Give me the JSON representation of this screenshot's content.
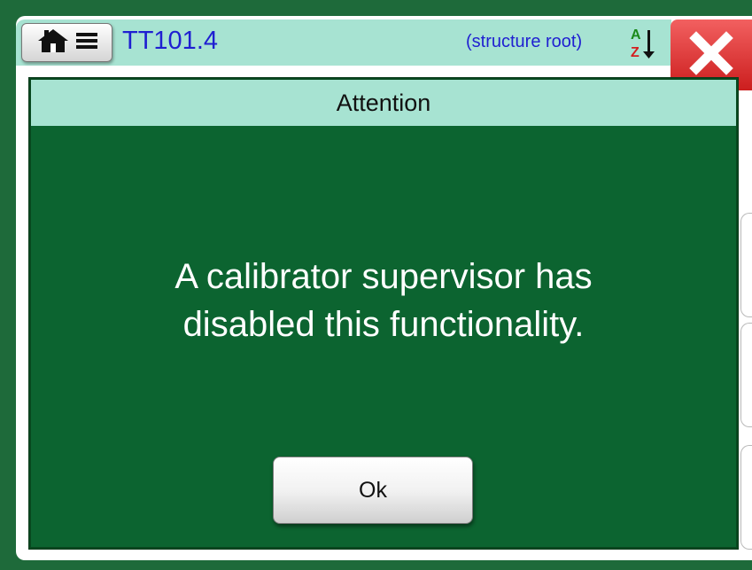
{
  "app": {
    "title": "TT101.4",
    "breadcrumb": "(structure root)",
    "accent": "#0c6430",
    "header_bg": "#a7e3d2",
    "title_color": "#1f1fd1",
    "close_color": "#dd2a2a"
  },
  "icons": {
    "home": "home-icon",
    "menu": "menu-icon",
    "sort": "sort-az-icon",
    "close": "close-icon"
  },
  "dialog": {
    "title": "Attention",
    "message_line1": "A calibrator supervisor has",
    "message_line2": "disabled this functionality.",
    "ok_label": "Ok"
  }
}
